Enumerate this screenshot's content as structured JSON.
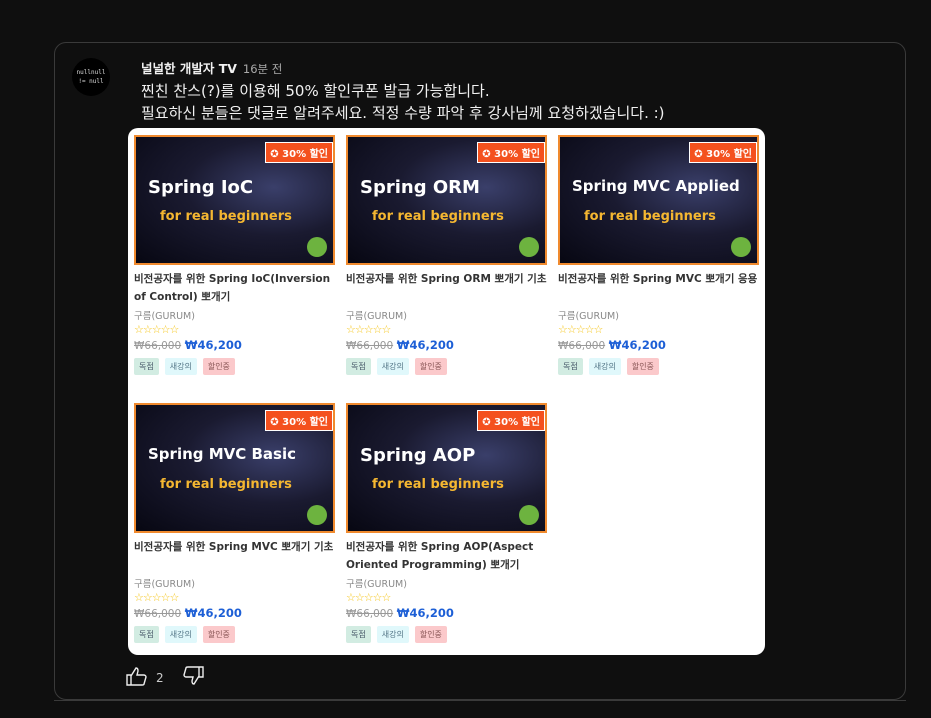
{
  "comment": {
    "author": "널널한 개발자 TV",
    "time": "16분 전",
    "avatar_text": [
      "nullnull",
      "!= null"
    ],
    "lines": [
      "찐친 찬스(?)를 이용해 50% 할인쿠폰 발급 가능합니다.",
      "필요하신 분들은 댓글로 알려주세요. 적정 수량 파악 후 강사님께 요청하겠습니다. :)"
    ],
    "likes": "2"
  },
  "courses": [
    {
      "thumb": "Spring IoC",
      "sub": "for real beginners",
      "badge": "30% 할인",
      "title": "비전공자를 위한 Spring IoC(Inversion of Control) 뽀개기",
      "instructor": "구름(GURUM)",
      "stars": "☆☆☆☆☆",
      "old_price": "₩66,000",
      "price": "₩46,200",
      "tags": [
        "독점",
        "새강의",
        "할인중"
      ]
    },
    {
      "thumb": "Spring ORM",
      "sub": "for real beginners",
      "badge": "30% 할인",
      "title": "비전공자를 위한 Spring ORM 뽀개기 기초",
      "instructor": "구름(GURUM)",
      "stars": "☆☆☆☆☆",
      "old_price": "₩66,000",
      "price": "₩46,200",
      "tags": [
        "독점",
        "새강의",
        "할인중"
      ]
    },
    {
      "thumb": "Spring MVC Applied",
      "sub": "for real beginners",
      "badge": "30% 할인",
      "title": "비전공자를 위한 Spring MVC 뽀개기 응용",
      "instructor": "구름(GURUM)",
      "stars": "☆☆☆☆☆",
      "old_price": "₩66,000",
      "price": "₩46,200",
      "tags": [
        "독점",
        "새강의",
        "할인중"
      ]
    },
    {
      "thumb": "Spring MVC Basic",
      "sub": "for real beginners",
      "badge": "30% 할인",
      "title": "비전공자를 위한 Spring MVC 뽀개기 기초",
      "instructor": "구름(GURUM)",
      "stars": "☆☆☆☆☆",
      "old_price": "₩66,000",
      "price": "₩46,200",
      "tags": [
        "독점",
        "새강의",
        "할인중"
      ]
    },
    {
      "thumb": "Spring AOP",
      "sub": "for real beginners",
      "badge": "30% 할인",
      "title": "비전공자를 위한 Spring AOP(Aspect Oriented Programming) 뽀개기",
      "instructor": "구름(GURUM)",
      "stars": "☆☆☆☆☆",
      "old_price": "₩66,000",
      "price": "₩46,200",
      "tags": [
        "독점",
        "새강의",
        "할인중"
      ]
    }
  ]
}
